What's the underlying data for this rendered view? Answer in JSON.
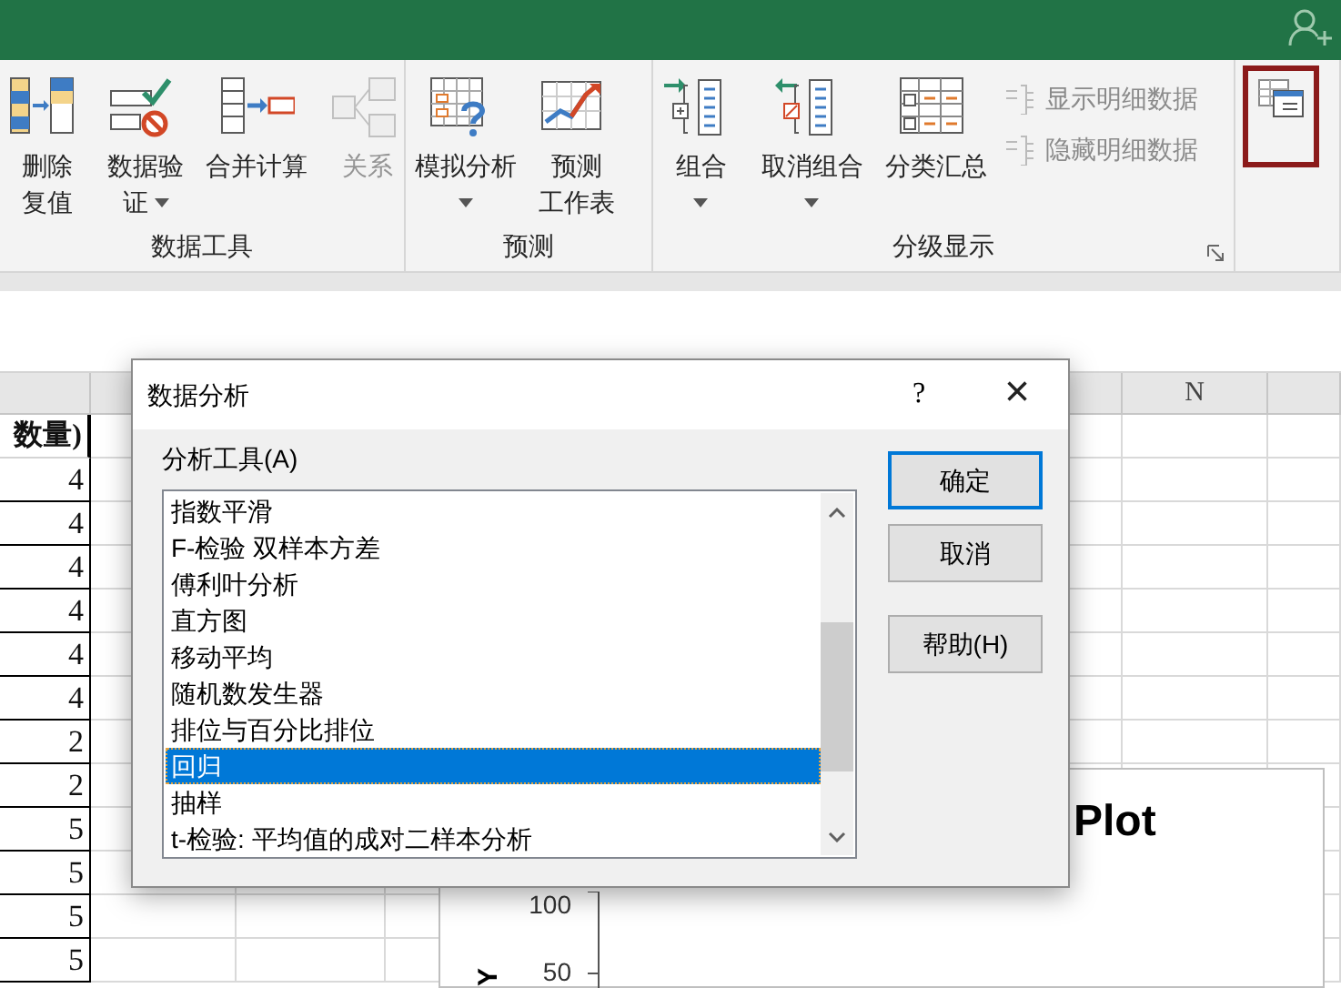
{
  "ribbon": {
    "groups": [
      {
        "label": "数据工具",
        "buttons": [
          {
            "kind": "large",
            "lines": [
              "删除",
              "复值"
            ],
            "caret": false,
            "disabled": false
          },
          {
            "kind": "large",
            "lines": [
              "数据验",
              "证"
            ],
            "caret": true,
            "caret_inline": true,
            "disabled": false
          },
          {
            "kind": "large",
            "lines": [
              "合并计算"
            ],
            "caret": false,
            "disabled": false
          },
          {
            "kind": "large",
            "lines": [
              "关系"
            ],
            "caret": false,
            "disabled": true
          }
        ]
      },
      {
        "label": "预测",
        "buttons": [
          {
            "kind": "large",
            "lines": [
              "模拟分析"
            ],
            "caret": true,
            "disabled": false
          },
          {
            "kind": "large",
            "lines": [
              "预测",
              "工作表"
            ],
            "caret": false,
            "disabled": false
          }
        ]
      },
      {
        "label": "分级显示",
        "launcher": true,
        "buttons": [
          {
            "kind": "large",
            "lines": [
              "组合"
            ],
            "caret": true,
            "disabled": false
          },
          {
            "kind": "large",
            "lines": [
              "取消组合"
            ],
            "caret": true,
            "disabled": false
          },
          {
            "kind": "large",
            "lines": [
              "分类汇总"
            ],
            "caret": false,
            "disabled": false
          },
          {
            "kind": "small",
            "lines": [
              "显示明细数据"
            ],
            "disabled": true
          },
          {
            "kind": "small",
            "lines": [
              "隐藏明细数据"
            ],
            "disabled": true
          }
        ]
      },
      {
        "buttons": [
          {
            "kind": "large",
            "disabled": false,
            "highlighted": true
          }
        ]
      }
    ]
  },
  "sheet": {
    "column_header": "N",
    "header_cell": "数量)",
    "values": [
      "4",
      "4",
      "4",
      "4",
      "4",
      "4",
      "2",
      "2",
      "5",
      "5",
      "5",
      "5"
    ]
  },
  "chart": {
    "title": "Plot",
    "y_label": "Y",
    "y_ticks": [
      "100",
      "50"
    ]
  },
  "dialog": {
    "title": "数据分析",
    "help": "?",
    "close": "×",
    "list_label": "分析工具(A)",
    "items": [
      {
        "label": "指数平滑",
        "selected": false
      },
      {
        "label": "F-检验 双样本方差",
        "selected": false
      },
      {
        "label": "傅利叶分析",
        "selected": false
      },
      {
        "label": "直方图",
        "selected": false
      },
      {
        "label": "移动平均",
        "selected": false
      },
      {
        "label": "随机数发生器",
        "selected": false
      },
      {
        "label": "排位与百分比排位",
        "selected": false
      },
      {
        "label": "回归",
        "selected": true
      },
      {
        "label": "抽样",
        "selected": false
      },
      {
        "label": "t-检验: 平均值的成对二样本分析",
        "selected": false
      }
    ],
    "buttons": [
      {
        "label": "确定",
        "default": true
      },
      {
        "label": "取消",
        "default": false
      },
      {
        "label": "帮助(H)",
        "default": false
      }
    ]
  }
}
